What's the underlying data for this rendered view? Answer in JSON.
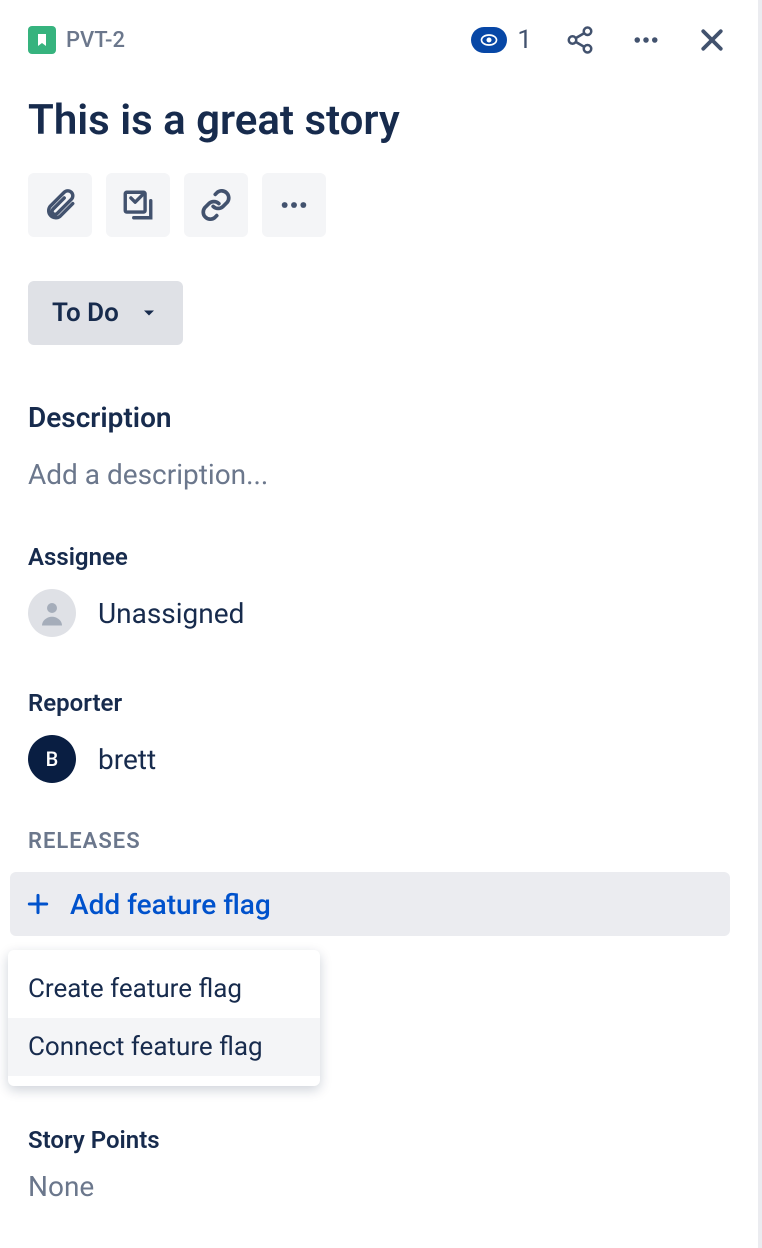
{
  "header": {
    "issue_key": "PVT-2",
    "watch_count": "1"
  },
  "title": "This is a great story",
  "status": {
    "label": "To Do"
  },
  "description": {
    "heading": "Description",
    "placeholder": "Add a description..."
  },
  "fields": {
    "assignee": {
      "label": "Assignee",
      "value": "Unassigned"
    },
    "reporter": {
      "label": "Reporter",
      "value": "brett",
      "initial": "B"
    }
  },
  "releases": {
    "heading": "RELEASES",
    "add_label": "Add feature flag",
    "menu": {
      "create": "Create feature flag",
      "connect": "Connect feature flag"
    }
  },
  "story_points": {
    "label": "Story Points",
    "value": "None"
  }
}
